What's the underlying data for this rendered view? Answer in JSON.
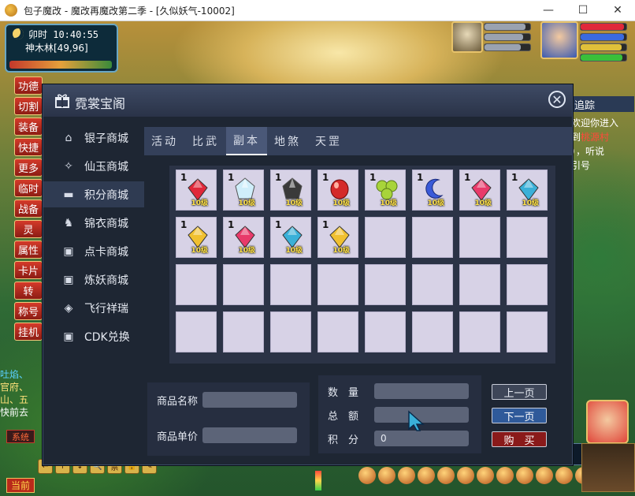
{
  "window": {
    "title": "包子魔改 - 魔改再魔改第二季 - [久似妖气-10002]",
    "minimize": "—",
    "maximize": "☐",
    "close": "✕"
  },
  "hud": {
    "time": "卯时 10:40:55",
    "location": "神木林[49,96]",
    "side_menu": [
      "功德",
      "切割",
      "装备",
      "快捷",
      "更多",
      "临时",
      "战备",
      "灵",
      "属性",
      "卡片",
      "转",
      "称号",
      "挂机"
    ],
    "chat_left": {
      "line1": "吐焰、",
      "line2": "官府、",
      "line3": "山、五",
      "line4": "快前去"
    },
    "system_tab": "系统",
    "current_tab": "当前",
    "bottom_buttons": [
      "←",
      "↑",
      "↓",
      "🔍",
      "禁",
      "🔒",
      "✎"
    ],
    "track_label": "追踪",
    "chat_right": {
      "l1": "欢迎你进入",
      "l2": "到",
      "l2b": "桃源村",
      "l3": "），听说",
      "l4": "引号"
    }
  },
  "dialog": {
    "title": "霓裳宝阁",
    "close_icon": "✕",
    "shops": [
      {
        "label": "银子商城",
        "icon": "⌂"
      },
      {
        "label": "仙玉商城",
        "icon": "✧"
      },
      {
        "label": "积分商城",
        "icon": "▬"
      },
      {
        "label": "锦衣商城",
        "icon": "♞"
      },
      {
        "label": "点卡商城",
        "icon": "▣"
      },
      {
        "label": "炼妖商城",
        "icon": "▣"
      },
      {
        "label": "飞行祥瑞",
        "icon": "◈"
      },
      {
        "label": "CDK兑换",
        "icon": "▣"
      }
    ],
    "active_shop": 2,
    "tabs": [
      "活动",
      "比武",
      "副本",
      "地煞",
      "天罡"
    ],
    "active_tab": 2,
    "items": [
      {
        "qty": "1",
        "level": "10级",
        "gem": "red"
      },
      {
        "qty": "1",
        "level": "10级",
        "gem": "crystal"
      },
      {
        "qty": "1",
        "level": "10级",
        "gem": "black"
      },
      {
        "qty": "1",
        "level": "10级",
        "gem": "ruby-oval"
      },
      {
        "qty": "1",
        "level": "10级",
        "gem": "green-pearls"
      },
      {
        "qty": "1",
        "level": "10级",
        "gem": "blue-moon"
      },
      {
        "qty": "1",
        "level": "10级",
        "gem": "pink"
      },
      {
        "qty": "1",
        "level": "10级",
        "gem": "cyan"
      },
      {
        "qty": "1",
        "level": "10级",
        "gem": "yellow"
      },
      {
        "qty": "1",
        "level": "10级",
        "gem": "pink"
      },
      {
        "qty": "1",
        "level": "10级",
        "gem": "cyan"
      },
      {
        "qty": "1",
        "level": "10级",
        "gem": "yellow"
      }
    ],
    "info": {
      "name_label": "商品名称",
      "price_label": "商品单价",
      "quantity_label": "数　量",
      "total_label": "总　额",
      "points_label": "积　分",
      "points_value": "0"
    },
    "buttons": {
      "prev": "上一页",
      "next": "下一页",
      "buy": "购　买"
    }
  },
  "colors": {
    "red": "#e0283a",
    "crystal": "#cfeefa",
    "black": "#3a3a3a",
    "ruby-oval": "#d42a2a",
    "green-pearls": "#a8d43a",
    "blue-moon": "#3a5ad8",
    "pink": "#e83a6a",
    "cyan": "#3ab0d8",
    "yellow": "#f0c030"
  }
}
